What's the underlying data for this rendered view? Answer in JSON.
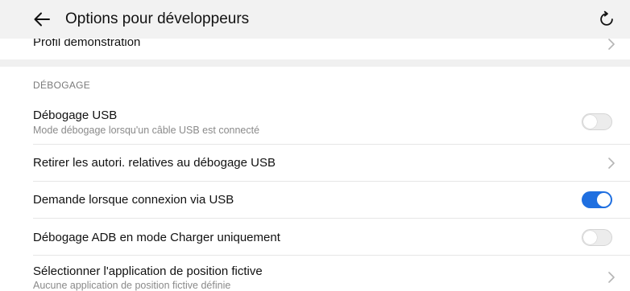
{
  "header": {
    "title": "Options pour développeurs",
    "back_icon": "arrow-left-icon",
    "refresh_icon": "refresh-icon"
  },
  "partial_row": {
    "label": "Profil démonstration"
  },
  "section": {
    "title": "DÉBOGAGE"
  },
  "settings": [
    {
      "title": "Débogage USB",
      "subtitle": "Mode débogage lorsqu'un câble USB est connecté",
      "control": "toggle",
      "enabled": false
    },
    {
      "title": "Retirer les autori. relatives au débogage USB",
      "control": "chevron"
    },
    {
      "title": "Demande lorsque connexion via USB",
      "control": "toggle",
      "enabled": true
    },
    {
      "title": "Débogage ADB en mode Charger uniquement",
      "control": "toggle",
      "enabled": false
    },
    {
      "title": "Sélectionner l'application de position fictive",
      "subtitle": "Aucune application de position fictive définie",
      "control": "chevron"
    }
  ],
  "colors": {
    "accent": "#1f6fe0",
    "header_bg": "#f2f2f2",
    "section_gap": "#f0f0f0",
    "divider": "#e6e6e6"
  }
}
